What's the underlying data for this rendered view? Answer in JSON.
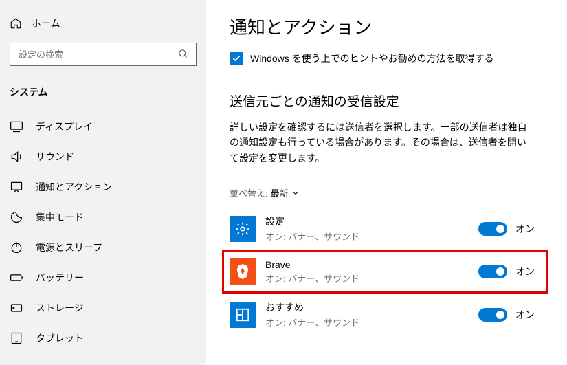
{
  "sidebar": {
    "home": "ホーム",
    "search_placeholder": "設定の検索",
    "section": "システム",
    "items": [
      {
        "label": "ディスプレイ",
        "icon": "display-icon"
      },
      {
        "label": "サウンド",
        "icon": "sound-icon"
      },
      {
        "label": "通知とアクション",
        "icon": "notification-icon"
      },
      {
        "label": "集中モード",
        "icon": "focus-icon"
      },
      {
        "label": "電源とスリープ",
        "icon": "power-icon"
      },
      {
        "label": "バッテリー",
        "icon": "battery-icon"
      },
      {
        "label": "ストレージ",
        "icon": "storage-icon"
      },
      {
        "label": "タブレット",
        "icon": "tablet-icon"
      }
    ]
  },
  "main": {
    "title": "通知とアクション",
    "hint_checkbox_checked": true,
    "hint_text": "Windows を使う上でのヒントやお勧めの方法を取得する",
    "sub_heading": "送信元ごとの通知の受信設定",
    "description": "詳しい設定を確認するには送信者を選択します。一部の送信者は独自の通知設定も行っている場合があります。その場合は、送信者を開いて設定を変更します。",
    "sort_label": "並べ替え:",
    "sort_value": "最新",
    "senders": [
      {
        "name": "設定",
        "sub": "オン: バナー、サウンド",
        "icon": "gear-icon",
        "icon_bg": "blue",
        "toggle": "オン",
        "highlighted": false
      },
      {
        "name": "Brave",
        "sub": "オン: バナー、サウンド",
        "icon": "brave-icon",
        "icon_bg": "orange",
        "toggle": "オン",
        "highlighted": true
      },
      {
        "name": "おすすめ",
        "sub": "オン: バナー、サウンド",
        "icon": "suggest-icon",
        "icon_bg": "blue",
        "toggle": "オン",
        "highlighted": false
      }
    ]
  }
}
